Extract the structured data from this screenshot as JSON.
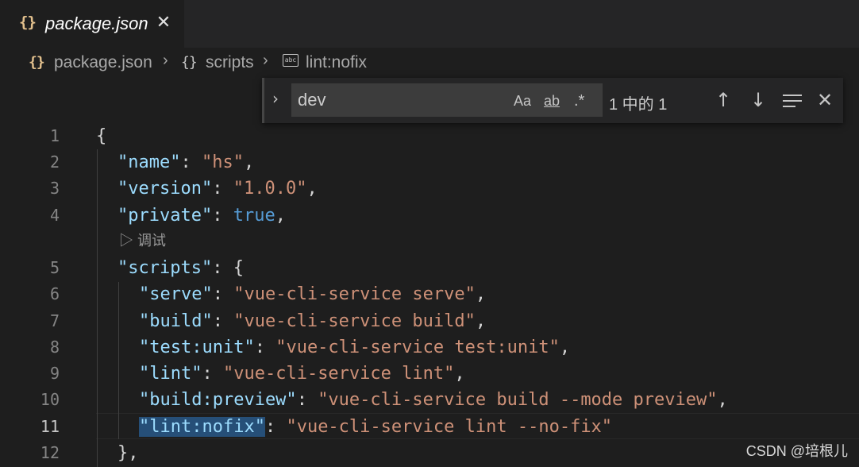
{
  "tab": {
    "icon": "{}",
    "title": "package.json",
    "close": "✕"
  },
  "breadcrumb": {
    "file_icon": "{}",
    "file": "package.json",
    "sep": "›",
    "object_icon": "{}",
    "scripts": "scripts",
    "string_icon": "abc",
    "current": "lint:nofix"
  },
  "find": {
    "toggle_icon": "›",
    "value": "dev",
    "match_case_label": "Aa",
    "whole_word_label": "ab",
    "regex_label": ".*",
    "count": "1 中的 1",
    "prev_icon": "↑",
    "next_icon": "↓",
    "close_icon": "✕"
  },
  "editor": {
    "line_numbers": [
      "1",
      "2",
      "3",
      "4",
      "5",
      "6",
      "7",
      "8",
      "9",
      "10",
      "11",
      "12"
    ],
    "codelens": "▷ 调试",
    "lines": {
      "l1": {
        "brace": "{"
      },
      "l2": {
        "key": "\"name\"",
        "colon": ": ",
        "val": "\"hs\"",
        "comma": ","
      },
      "l3": {
        "key": "\"version\"",
        "colon": ": ",
        "val": "\"1.0.0\"",
        "comma": ","
      },
      "l4": {
        "key": "\"private\"",
        "colon": ": ",
        "val": "true",
        "comma": ","
      },
      "l5": {
        "key": "\"scripts\"",
        "colon": ": ",
        "brace": "{"
      },
      "l6": {
        "key": "\"serve\"",
        "colon": ": ",
        "val": "\"vue-cli-service serve\"",
        "comma": ","
      },
      "l7": {
        "key": "\"build\"",
        "colon": ": ",
        "val": "\"vue-cli-service build\"",
        "comma": ","
      },
      "l8": {
        "key": "\"test:unit\"",
        "colon": ": ",
        "val": "\"vue-cli-service test:unit\"",
        "comma": ","
      },
      "l9": {
        "key": "\"lint\"",
        "colon": ": ",
        "val": "\"vue-cli-service lint\"",
        "comma": ","
      },
      "l10": {
        "key": "\"build:preview\"",
        "colon": ": ",
        "val": "\"vue-cli-service build --mode preview\"",
        "comma": ","
      },
      "l11": {
        "key": "\"lint:nofix\"",
        "colon": ": ",
        "val": "\"vue-cli-service lint --no-fix\""
      },
      "l12": {
        "brace": "},"
      }
    }
  },
  "watermark": "CSDN @培根儿",
  "colors": {
    "background": "#1e1e1e",
    "key": "#9cdcfe",
    "string": "#ce9178",
    "boolean": "#569cd6",
    "json_icon": "#e2c08d"
  }
}
